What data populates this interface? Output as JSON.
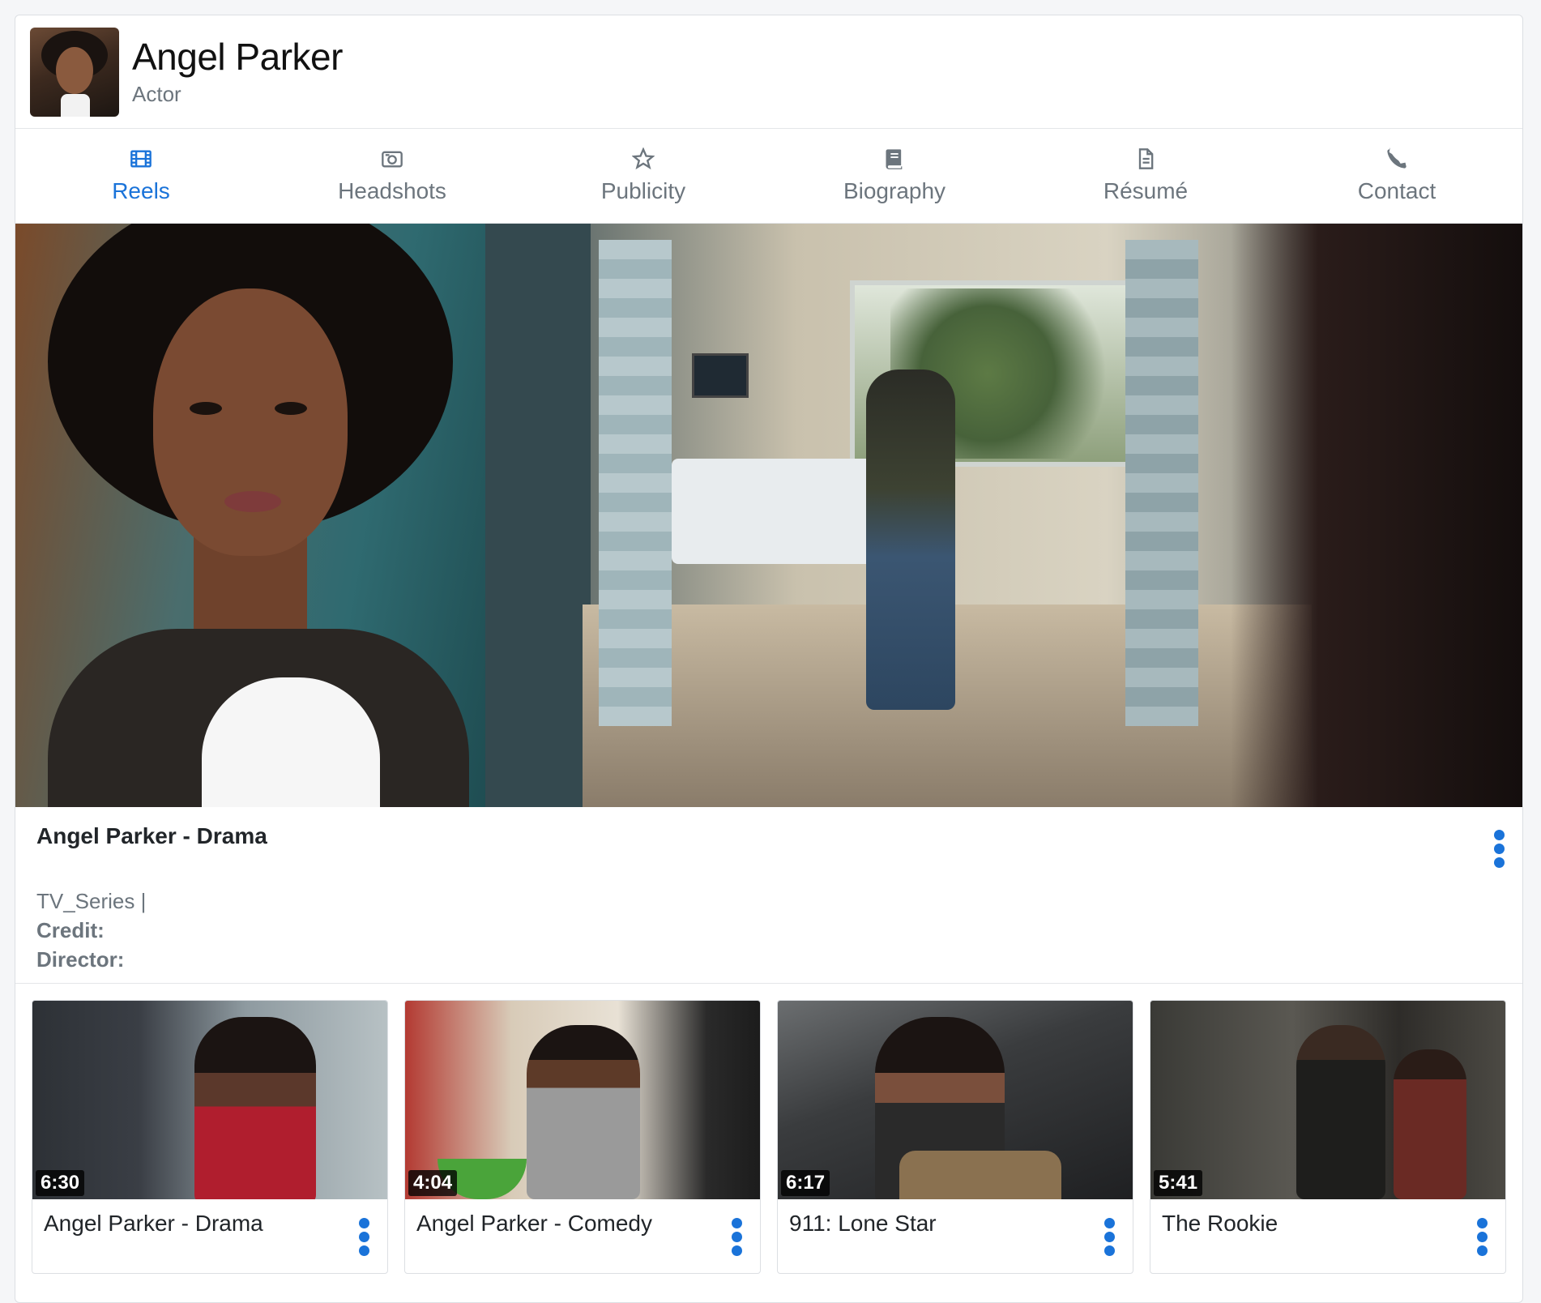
{
  "profile": {
    "name": "Angel Parker",
    "role": "Actor"
  },
  "tabs": [
    {
      "label": "Reels",
      "icon": "film-icon",
      "active": true
    },
    {
      "label": "Headshots",
      "icon": "camera-icon",
      "active": false
    },
    {
      "label": "Publicity",
      "icon": "star-icon",
      "active": false
    },
    {
      "label": "Biography",
      "icon": "book-icon",
      "active": false
    },
    {
      "label": "Résumé",
      "icon": "document-icon",
      "active": false
    },
    {
      "label": "Contact",
      "icon": "phone-icon",
      "active": false
    }
  ],
  "featured_reel": {
    "title": "Angel Parker - Drama",
    "category": "TV_Series |",
    "credit_label": "Credit:",
    "director_label": "Director:"
  },
  "reels": [
    {
      "title": "Angel Parker - Drama",
      "duration": "6:30"
    },
    {
      "title": "Angel Parker - Comedy",
      "duration": "4:04"
    },
    {
      "title": "911: Lone Star",
      "duration": "6:17"
    },
    {
      "title": "The Rookie",
      "duration": "5:41"
    }
  ],
  "colors": {
    "accent": "#1a73d9",
    "muted": "#6c757d"
  }
}
